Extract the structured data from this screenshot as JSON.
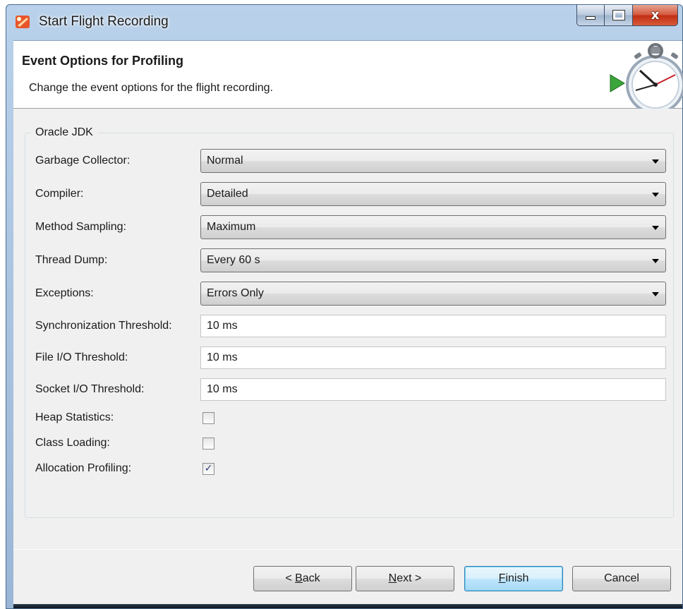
{
  "window": {
    "title": "Start Flight Recording"
  },
  "header": {
    "title": "Event Options for Profiling",
    "description": "Change the event options for the flight recording."
  },
  "group": {
    "legend": "Oracle JDK",
    "combos": [
      {
        "label": "Garbage Collector:",
        "value": "Normal"
      },
      {
        "label": "Compiler:",
        "value": "Detailed"
      },
      {
        "label": "Method Sampling:",
        "value": "Maximum"
      },
      {
        "label": "Thread Dump:",
        "value": "Every 60 s"
      },
      {
        "label": "Exceptions:",
        "value": "Errors Only"
      }
    ],
    "fields": [
      {
        "label": "Synchronization Threshold:",
        "value": "10 ms"
      },
      {
        "label": "File I/O Threshold:",
        "value": "10 ms"
      },
      {
        "label": "Socket I/O Threshold:",
        "value": "10 ms"
      }
    ],
    "checkboxes": [
      {
        "label": "Heap Statistics:",
        "checked": false
      },
      {
        "label": "Class Loading:",
        "checked": false
      },
      {
        "label": "Allocation Profiling:",
        "checked": true
      }
    ]
  },
  "buttons": {
    "back": {
      "prefix": "< ",
      "accel": "B",
      "rest": "ack"
    },
    "next": {
      "accel": "N",
      "rest": "ext >"
    },
    "finish": {
      "accel": "F",
      "rest": "inish"
    },
    "cancel": "Cancel"
  },
  "icons": {
    "window_icon": "flight-recorder-icon",
    "header_graphic": "stopwatch-icon"
  },
  "colors": {
    "title_bar": "#b9d1ea",
    "close_button": "#c12e12",
    "default_button_border": "#3c7fb1",
    "dialog_background": "#f0f0f0"
  }
}
